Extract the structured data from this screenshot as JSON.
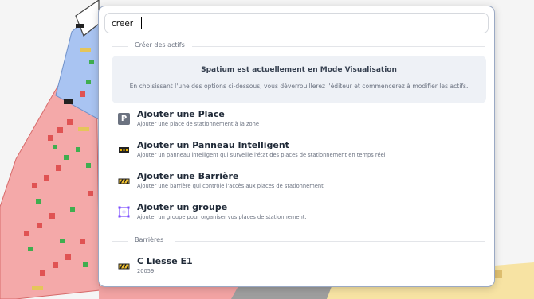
{
  "search": {
    "value": "creer",
    "placeholder": ""
  },
  "sections": {
    "create_assets": "Créer des actifs",
    "barriers": "Barrières"
  },
  "info": {
    "title": "Spatium est actuellement en Mode Visualisation",
    "body": "En choisissant l'une des options ci-dessous, vous déverrouillerez l'éditeur et commencerez à modifier les actifs."
  },
  "actions": [
    {
      "icon": "parking-icon",
      "title": "Ajouter une Place",
      "desc": "Ajouter une place de stationnement à la zone"
    },
    {
      "icon": "smart-panel-icon",
      "title": "Ajouter un Panneau Intelligent",
      "desc": "Ajouter un panneau intelligent qui surveille l'état des places de stationnement en temps réel"
    },
    {
      "icon": "barrier-icon",
      "title": "Ajouter une Barrière",
      "desc": "Ajouter une barrière qui contrôle l'accès aux places de stationnement"
    },
    {
      "icon": "group-icon",
      "title": "Ajouter un groupe",
      "desc": "Ajouter un groupe pour organiser vos places de stationnement."
    }
  ],
  "barrier_results": [
    {
      "icon": "barrier-icon",
      "title": "C Liesse E1",
      "desc": "20059"
    }
  ],
  "colors": {
    "accent": "#7c4dff",
    "zone_red": "#f4a9a9",
    "zone_blue": "#a9c4f2",
    "zone_yellow": "#f7e3a3",
    "border": "#9aa9c4"
  }
}
